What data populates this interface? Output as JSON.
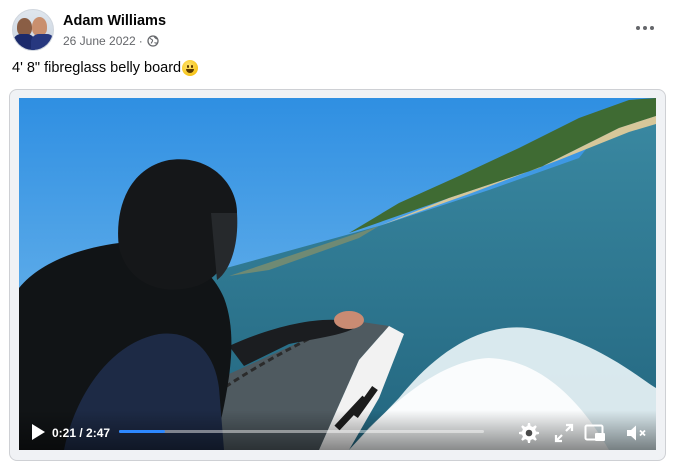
{
  "post": {
    "author": "Adam Williams",
    "date": "26 June 2022",
    "separator": "·",
    "privacy_icon": "globe-icon",
    "caption": "4' 8\" fibreglass belly board",
    "emoji": "grinning-face-emoji"
  },
  "video": {
    "time": "0:21 / 2:47",
    "progress": 0.126,
    "icons": [
      "play-icon",
      "settings-icon",
      "fullscreen-icon",
      "picture-in-picture-icon",
      "muted-speaker-icon"
    ],
    "accent": "#2d88ff"
  },
  "colors": {
    "author_text": "#050505",
    "secondary_text": "#65676b",
    "frame_border": "#ced0d4"
  }
}
